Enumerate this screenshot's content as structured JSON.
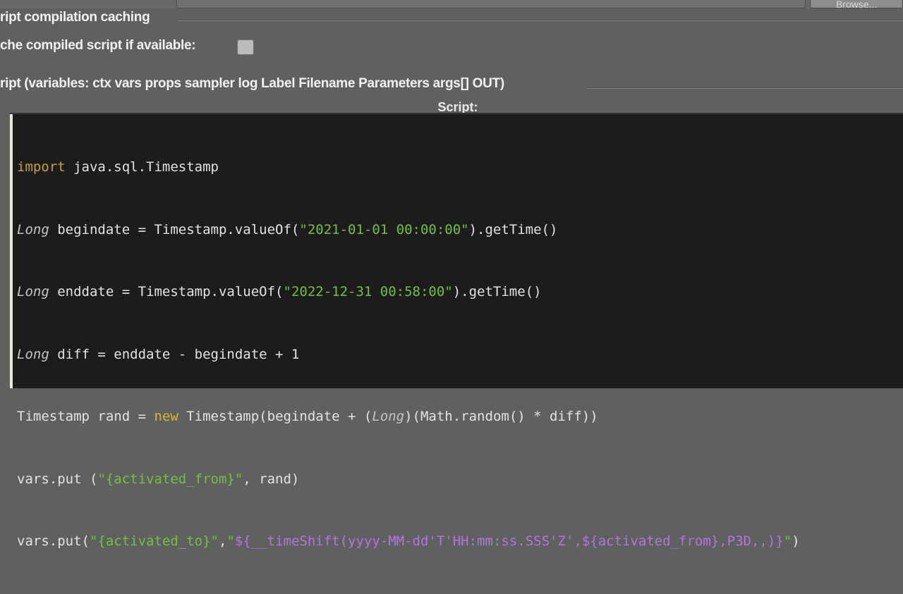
{
  "compilation": {
    "title": "ript compilation caching",
    "cache_label": "che compiled script if available:",
    "cache_checked": false
  },
  "script_section": {
    "title": "ript (variables: ctx vars props sampler log Label Filename Parameters args[] OUT)",
    "header": "Script:"
  },
  "top_button": {
    "label": "Browse..."
  },
  "code": {
    "line1": {
      "kw": "import",
      "rest": " java.sql.Timestamp"
    },
    "line2": {
      "kw": "Long",
      "a": " begindate = Timestamp.valueOf(",
      "s": "\"2021-01-01 00:00:00\"",
      "b": ").getTime()"
    },
    "line3": {
      "kw": "Long",
      "a": " enddate = Timestamp.valueOf(",
      "s": "\"2022-12-31 00:58:00\"",
      "b": ").getTime()"
    },
    "line4": {
      "kw": "Long",
      "a": " diff = enddate - begindate + 1"
    },
    "line5": {
      "a": "Timestamp rand = ",
      "kw_new": "new",
      "b": " Timestamp(begindate + (",
      "kw": "Long",
      "c": ")(Math.random() * diff))"
    },
    "line6": {
      "a": "vars.put (",
      "s": "\"{activated_from}\"",
      "b": ", rand)"
    },
    "line7": {
      "a": "vars.put(",
      "s1": "\"{activated_to}\"",
      "b": ",",
      "s2": "\"",
      "p": "${__timeShift(yyyy-MM-dd'T'HH:mm:ss.SSS'Z',${activated_from},P3D,,)}",
      "s3": "\"",
      "c": ")"
    }
  }
}
